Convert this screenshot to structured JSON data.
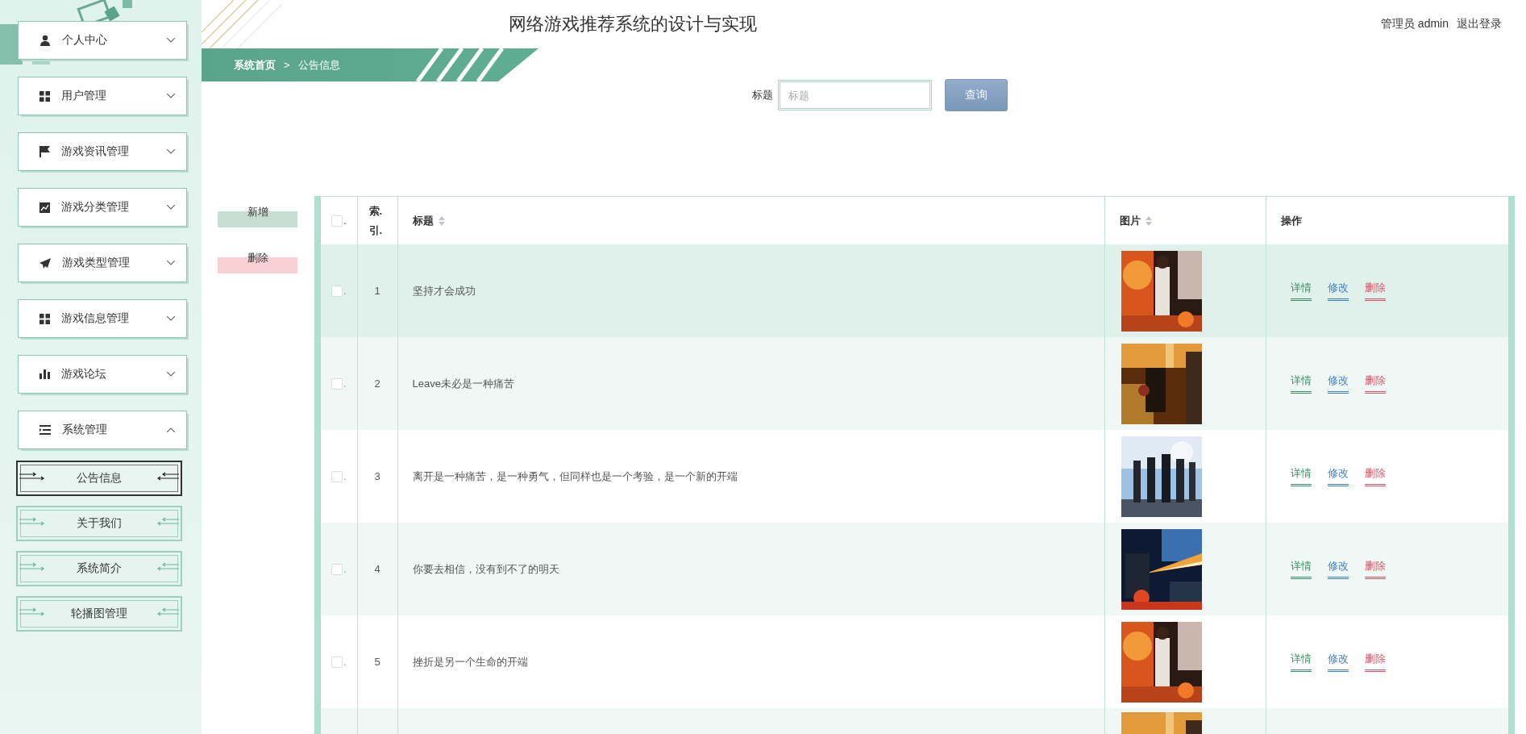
{
  "header": {
    "title": "网络游戏推荐系统的设计与实现",
    "user_role": "管理员",
    "username": "admin",
    "logout": "退出登录"
  },
  "sidebar": {
    "items": [
      {
        "label": "个人中心",
        "expanded": false
      },
      {
        "label": "用户管理",
        "expanded": false
      },
      {
        "label": "游戏资讯管理",
        "expanded": false
      },
      {
        "label": "游戏分类管理",
        "expanded": false
      },
      {
        "label": "游戏类型管理",
        "expanded": false
      },
      {
        "label": "游戏信息管理",
        "expanded": false
      },
      {
        "label": "游戏论坛",
        "expanded": false
      },
      {
        "label": "系统管理",
        "expanded": true,
        "children": [
          {
            "label": "公告信息",
            "selected": true
          },
          {
            "label": "关于我们",
            "selected": false
          },
          {
            "label": "系统简介",
            "selected": false
          },
          {
            "label": "轮播图管理",
            "selected": false
          }
        ]
      }
    ]
  },
  "breadcrumb": {
    "items": [
      "系统首页",
      "公告信息"
    ],
    "separator": ">"
  },
  "search": {
    "label": "标题",
    "placeholder": "标题",
    "button": "查询"
  },
  "actions": [
    {
      "label": "新增",
      "color": "#c7ddd4"
    },
    {
      "label": "删除",
      "color": "#f9d0d4"
    }
  ],
  "table": {
    "select_all": {
      "checked": false,
      "mark": "."
    },
    "columns": [
      {
        "label": "索.引.",
        "sortable": false
      },
      {
        "label": "标题",
        "sortable": true
      },
      {
        "label": "图片",
        "sortable": true
      },
      {
        "label": "操作",
        "sortable": false
      }
    ],
    "rows": [
      {
        "checked": false,
        "mark": ".",
        "index": "1",
        "title": "坚持才会成功",
        "highlighted": true,
        "image": {
          "kind": "picture"
        },
        "actions": [
          {
            "label": "详情",
            "color": "#3b8f6a"
          },
          {
            "label": "修改",
            "color": "#3b7fd0"
          },
          {
            "label": "删除",
            "color": "#dc5464"
          }
        ]
      },
      {
        "checked": false,
        "mark": ".",
        "index": "2",
        "title": "Leave未必是一种痛苦",
        "highlighted": false,
        "image": {
          "kind": "picture"
        },
        "actions": [
          {
            "label": "详情",
            "color": "#3b8f6a"
          },
          {
            "label": "修改",
            "color": "#3b7fd0"
          },
          {
            "label": "删除",
            "color": "#dc5464"
          }
        ]
      },
      {
        "checked": false,
        "mark": ".",
        "index": "3",
        "title": "离开是一种痛苦，是一种勇气，但同样也是一个考验，是一个新的开端",
        "highlighted": false,
        "image": {
          "kind": "picture"
        },
        "actions": [
          {
            "label": "详情",
            "color": "#3b8f6a"
          },
          {
            "label": "修改",
            "color": "#3b7fd0"
          },
          {
            "label": "删除",
            "color": "#dc5464"
          }
        ]
      },
      {
        "checked": false,
        "mark": ".",
        "index": "4",
        "title": "你要去相信，没有到不了的明天",
        "highlighted": false,
        "image": {
          "kind": "picture"
        },
        "actions": [
          {
            "label": "详情",
            "color": "#3b8f6a"
          },
          {
            "label": "修改",
            "color": "#3b7fd0"
          },
          {
            "label": "删除",
            "color": "#dc5464"
          }
        ]
      },
      {
        "checked": false,
        "mark": ".",
        "index": "5",
        "title": "挫折是另一个生命的开端",
        "highlighted": false,
        "image": {
          "kind": "picture"
        },
        "actions": [
          {
            "label": "详情",
            "color": "#3b8f6a"
          },
          {
            "label": "修改",
            "color": "#3b7fd0"
          },
          {
            "label": "删除",
            "color": "#dc5464"
          }
        ]
      },
      {
        "image": {
          "kind": "picture"
        }
      }
    ]
  }
}
